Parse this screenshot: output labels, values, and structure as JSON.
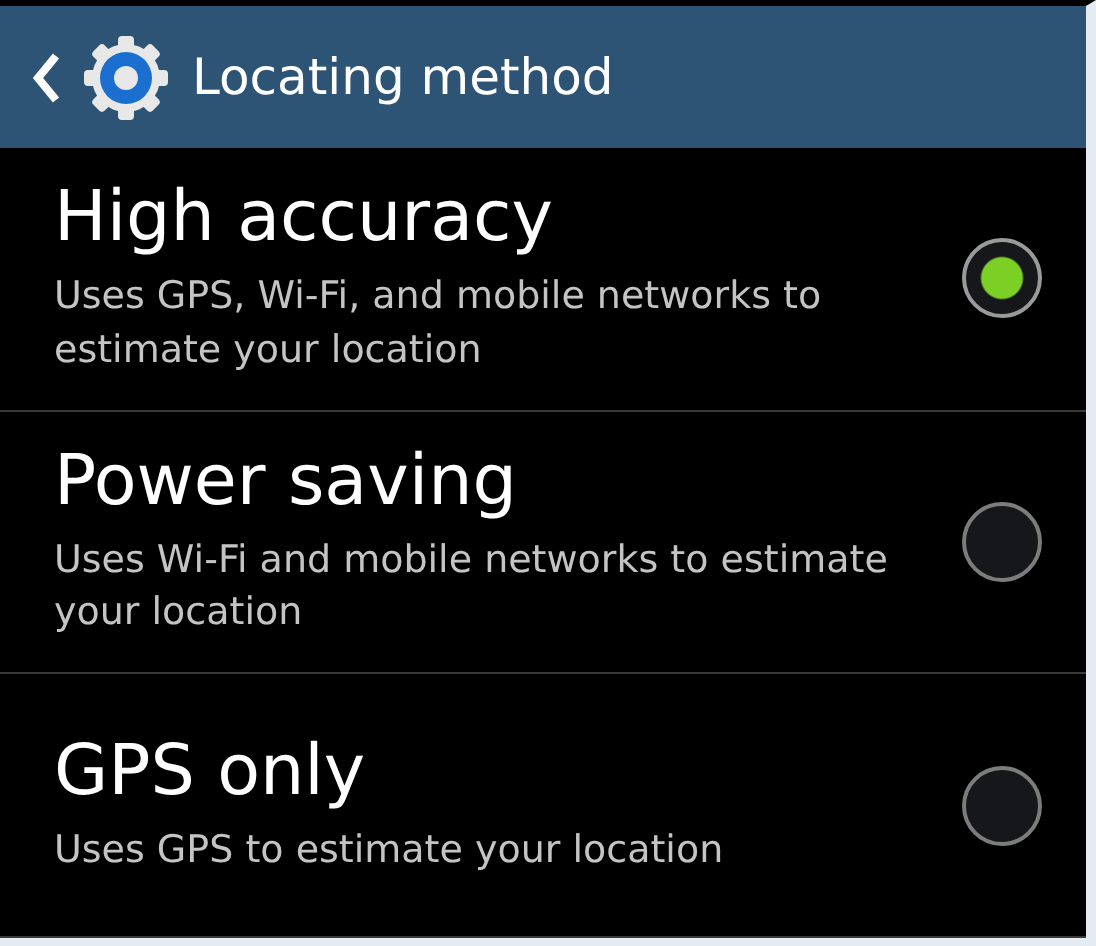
{
  "header": {
    "title": "Locating method"
  },
  "options": [
    {
      "title": "High accuracy",
      "description": "Uses GPS, Wi-Fi, and mobile networks to estimate your location",
      "selected": true
    },
    {
      "title": "Power saving",
      "description": "Uses Wi-Fi and mobile networks to estimate your location",
      "selected": false
    },
    {
      "title": "GPS only",
      "description": "Uses GPS to estimate your location",
      "selected": false
    }
  ]
}
